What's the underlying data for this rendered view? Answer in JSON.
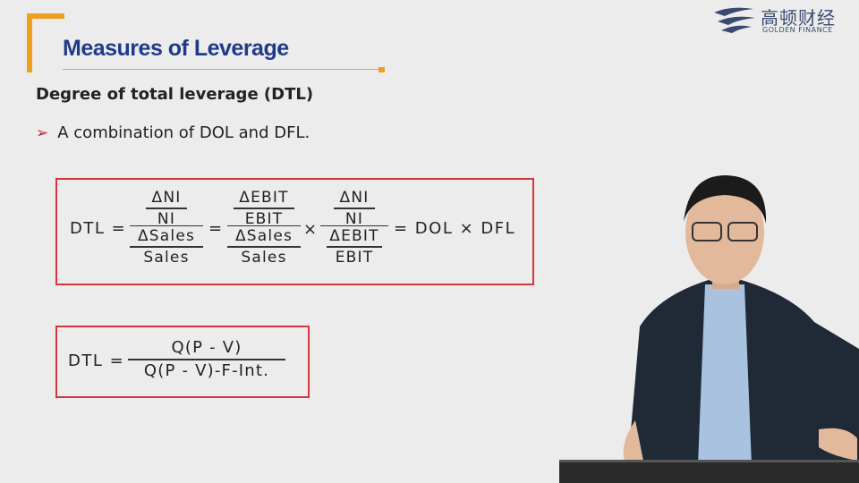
{
  "slide": {
    "title": "Measures of Leverage",
    "subtitle": "Degree of total leverage (DTL)",
    "bullet": "A combination of DOL and DFL."
  },
  "logo": {
    "chinese": "高顿财经",
    "english": "GOLDEN FINANCE"
  },
  "formula1": {
    "lhs": "DTL =",
    "f1": {
      "num_top": "ΔNI",
      "num_bot": "NI",
      "den_top": "ΔSales",
      "den_bot": "Sales"
    },
    "eq1": "=",
    "f2": {
      "num_top": "ΔEBIT",
      "num_bot": "EBIT",
      "den_top": "ΔSales",
      "den_bot": "Sales"
    },
    "times": "×",
    "f3": {
      "num_top": "ΔNI",
      "num_bot": "NI",
      "den_top": "ΔEBIT",
      "den_bot": "EBIT"
    },
    "rhs": "= DOL × DFL"
  },
  "formula2": {
    "lhs": "DTL =",
    "numerator": "Q(P - V)",
    "denominator": "Q(P - V)-F-Int."
  },
  "colors": {
    "accent_orange": "#f0a020",
    "title_blue": "#1f3a8a",
    "box_red": "#d7343e",
    "arrow_red": "#c0202c"
  }
}
